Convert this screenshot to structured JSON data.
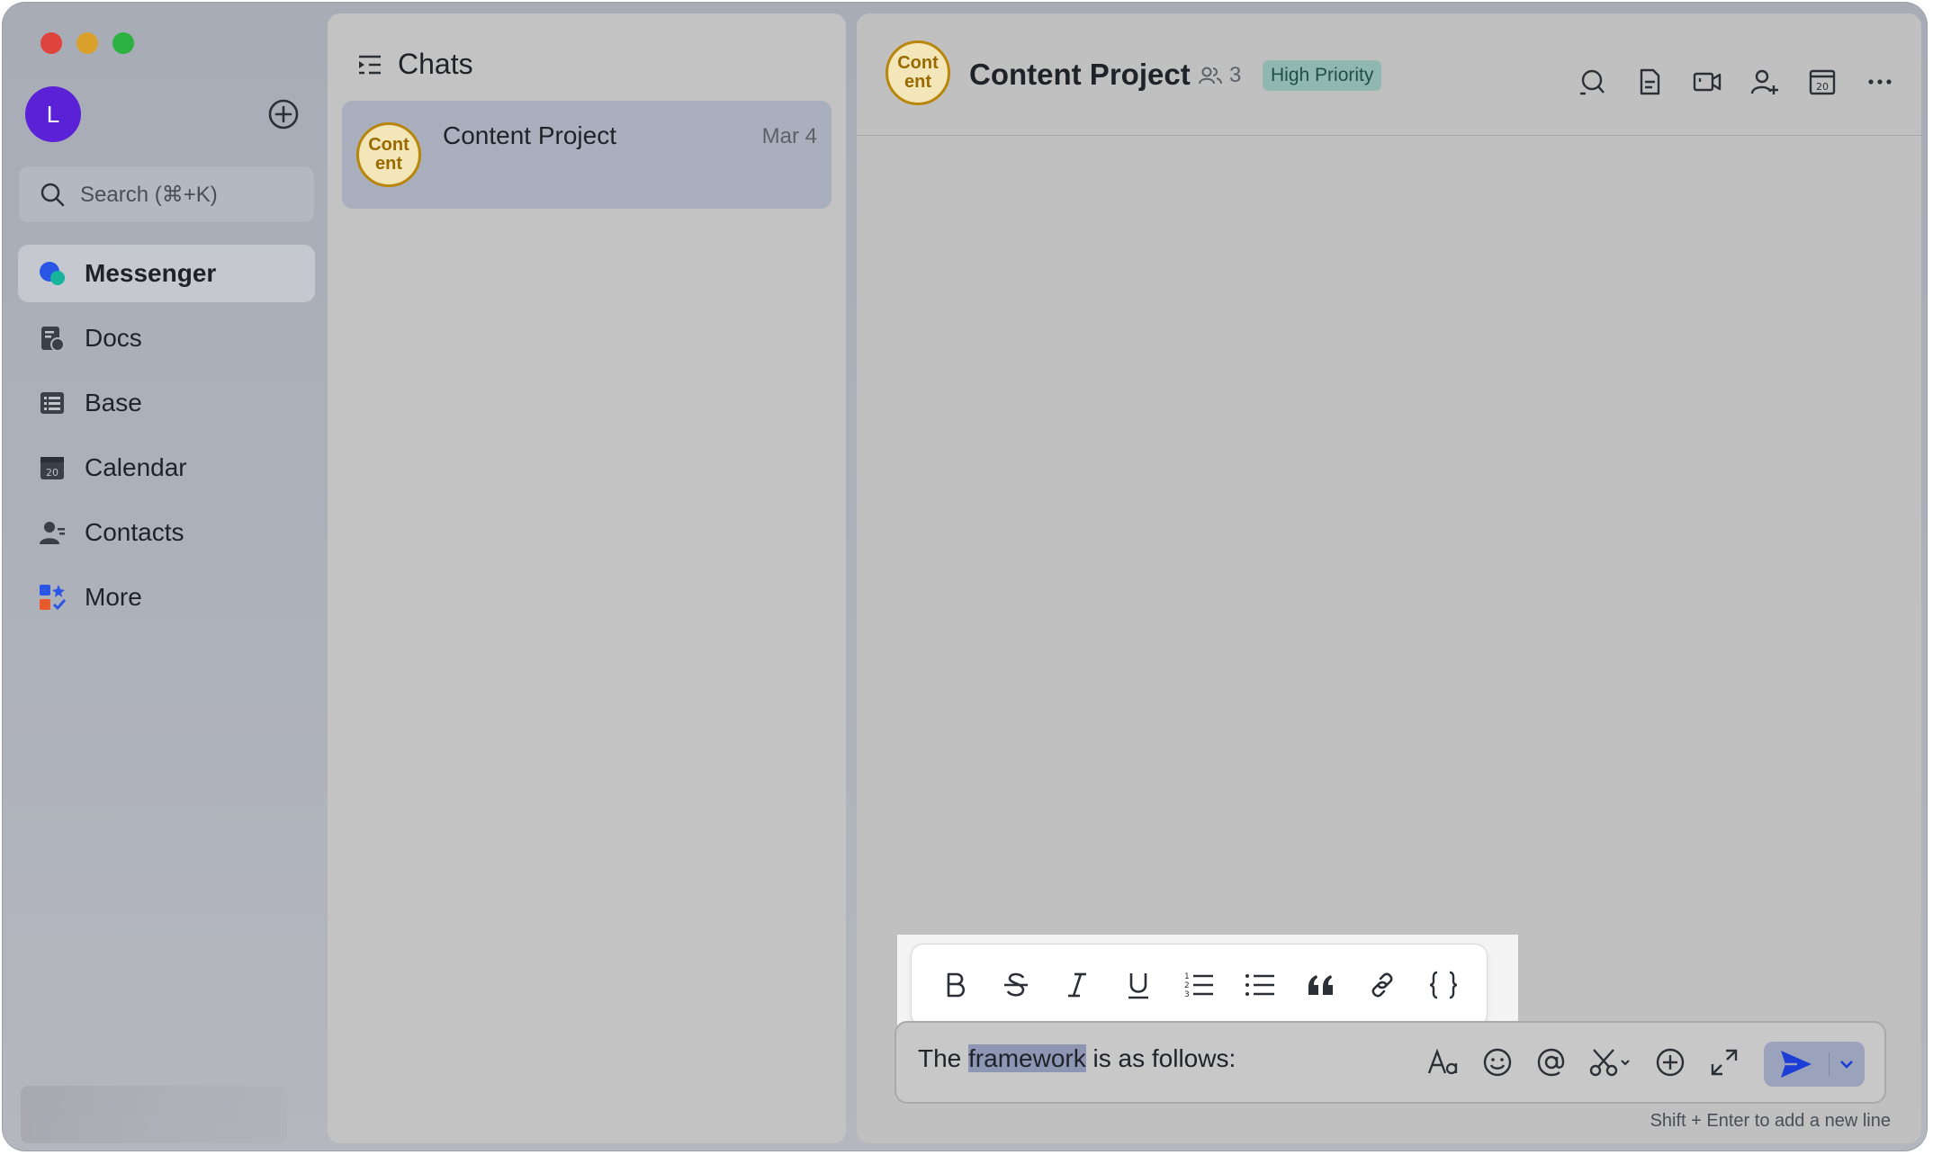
{
  "user": {
    "initial": "L"
  },
  "search": {
    "placeholder": "Search (⌘+K)"
  },
  "nav": {
    "items": [
      {
        "label": "Messenger",
        "icon": "messenger-icon",
        "active": true
      },
      {
        "label": "Docs",
        "icon": "docs-icon"
      },
      {
        "label": "Base",
        "icon": "base-icon"
      },
      {
        "label": "Calendar",
        "icon": "calendar-icon"
      },
      {
        "label": "Contacts",
        "icon": "contacts-icon"
      },
      {
        "label": "More",
        "icon": "more-apps-icon"
      }
    ]
  },
  "chats": {
    "title": "Chats",
    "items": [
      {
        "name": "Content Project",
        "date": "Mar 4",
        "avatar_line1": "Cont",
        "avatar_line2": "ent"
      }
    ]
  },
  "conversation": {
    "title": "Content Project",
    "avatar_line1": "Cont",
    "avatar_line2": "ent",
    "member_count": "3",
    "badge": "High Priority",
    "badge_color": "#90b8b0",
    "header_icons": [
      "search-icon",
      "document-icon",
      "video-call-icon",
      "add-member-icon",
      "calendar-icon",
      "more-icon"
    ]
  },
  "formatting": {
    "tools": [
      "bold",
      "strikethrough",
      "italic",
      "underline",
      "numbered-list",
      "bulleted-list",
      "quote",
      "link",
      "code-block"
    ]
  },
  "composer": {
    "text_before": "The ",
    "text_selected": "framework",
    "text_after": " is as follows:",
    "hint": "Shift + Enter to add a new line",
    "send_color": "#1d3ed6"
  },
  "colors": {
    "accent": "#1d3ed6",
    "avatar_user": "#5b21d6",
    "group_avatar_border": "#b8860b"
  }
}
